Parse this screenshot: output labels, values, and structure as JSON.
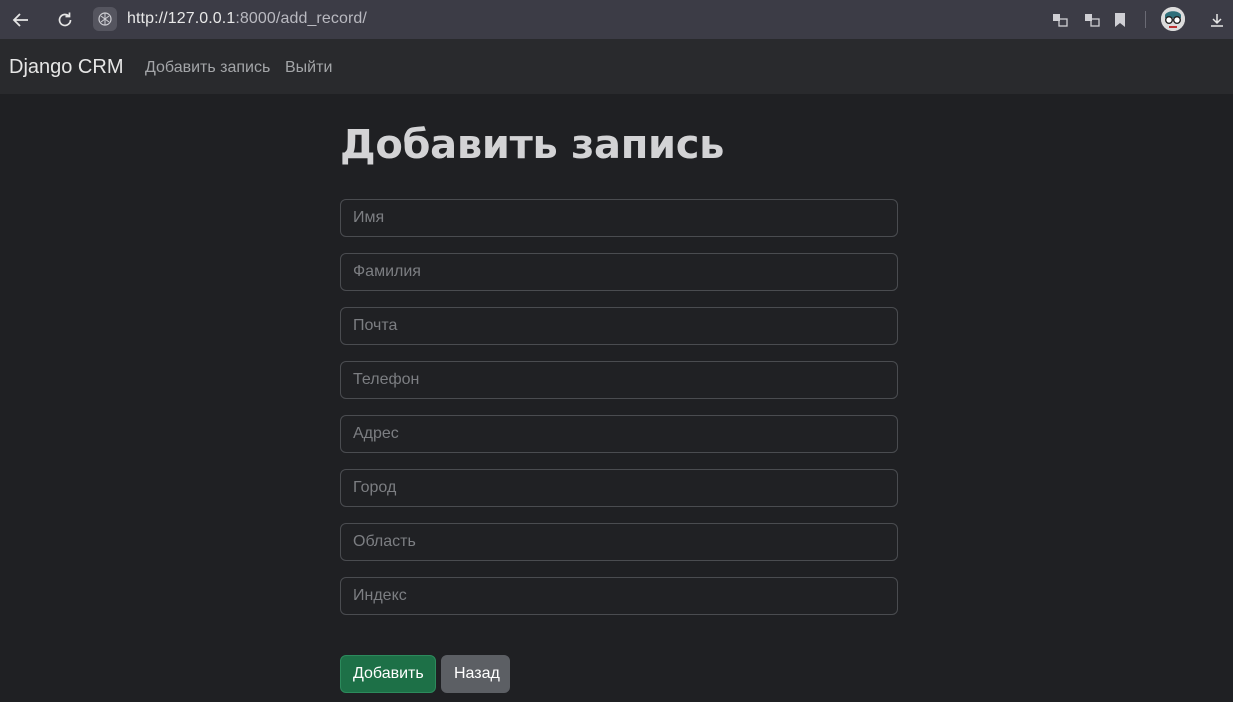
{
  "browser": {
    "url_host": "http://127.0.0.1",
    "url_rest": ":8000/add_record/"
  },
  "navbar": {
    "brand": "Django CRM",
    "links": [
      "Добавить запись",
      "Выйти"
    ]
  },
  "main": {
    "title": "Добавить запись",
    "fields": [
      {
        "placeholder": "Имя",
        "value": ""
      },
      {
        "placeholder": "Фамилия",
        "value": ""
      },
      {
        "placeholder": "Почта",
        "value": ""
      },
      {
        "placeholder": "Телефон",
        "value": ""
      },
      {
        "placeholder": "Адрес",
        "value": ""
      },
      {
        "placeholder": "Город",
        "value": ""
      },
      {
        "placeholder": "Область",
        "value": ""
      },
      {
        "placeholder": "Индекс",
        "value": ""
      }
    ],
    "submit_label": "Добавить",
    "back_label": "Назад"
  },
  "colors": {
    "page_bg": "#1f2023",
    "navbar_bg": "#292a2d",
    "success": "#1d7047",
    "secondary": "#5c5f64"
  },
  "icons": [
    "back-arrow-icon",
    "reload-icon",
    "site-info-icon",
    "translate-icon",
    "translate-alt-icon",
    "bookmark-icon",
    "profile-avatar-icon",
    "download-icon"
  ]
}
